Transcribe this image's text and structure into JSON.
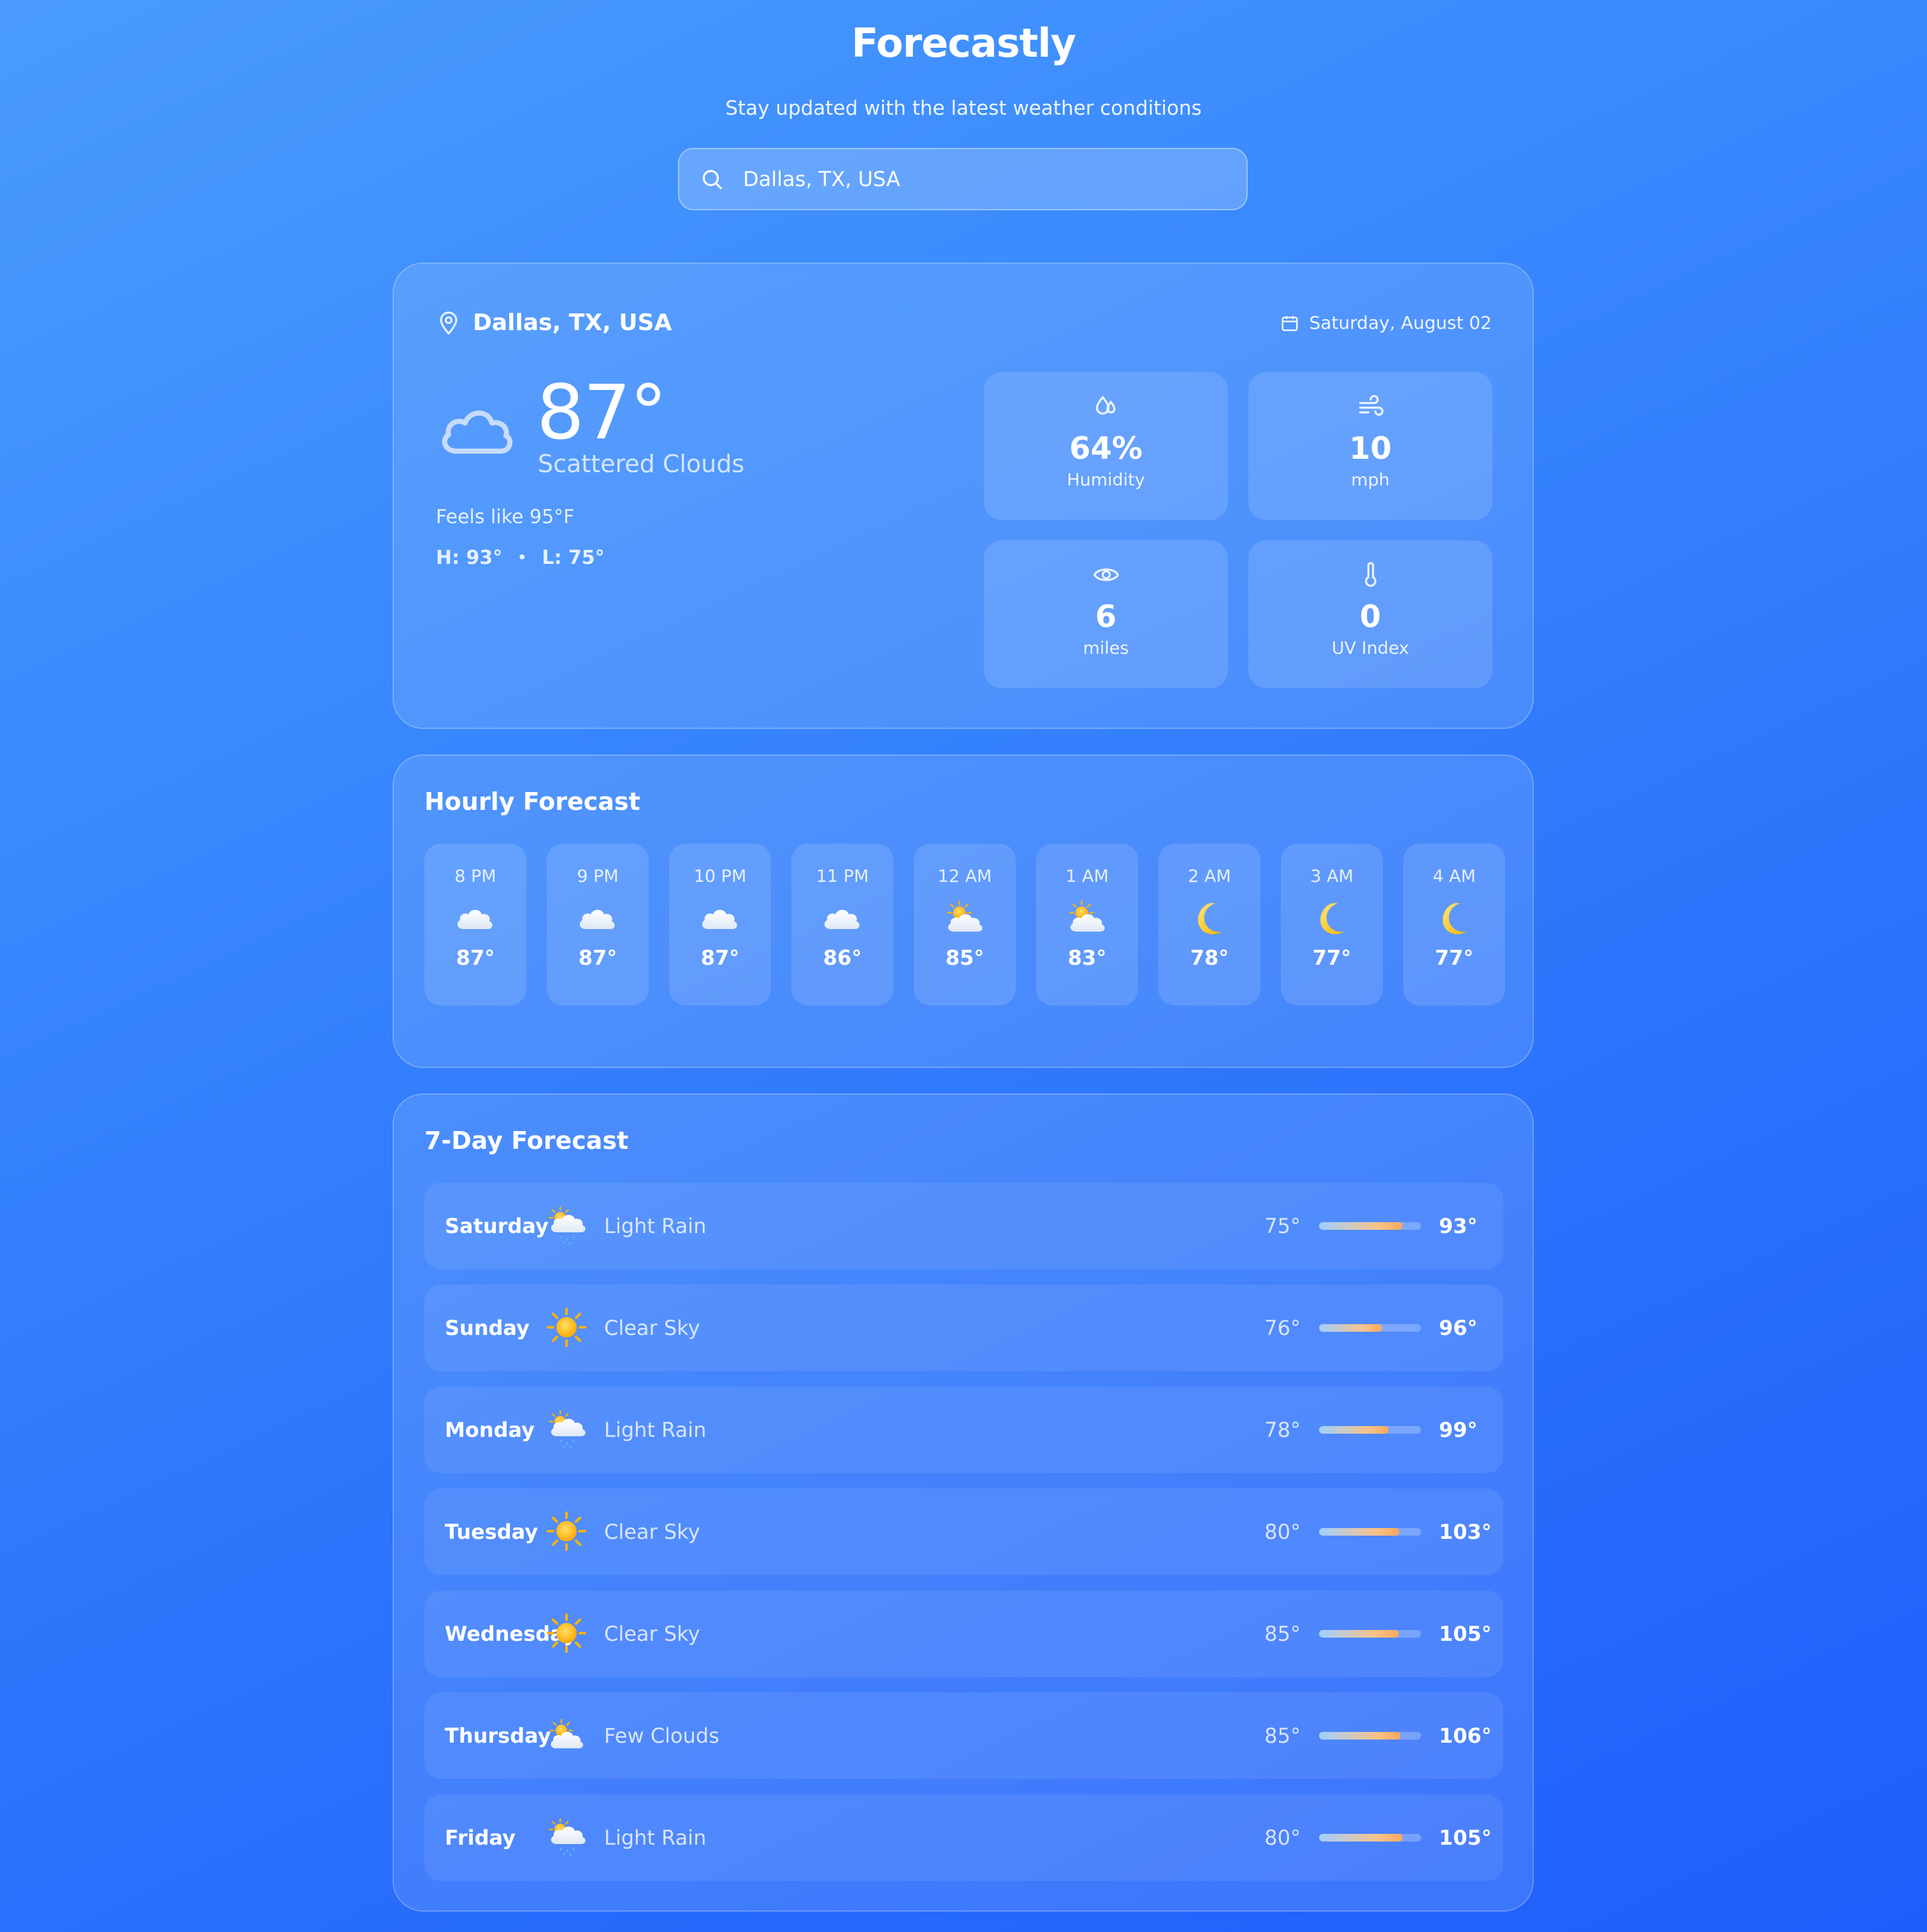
{
  "app": {
    "title": "Forecastly",
    "subtitle": "Stay updated with the latest weather conditions"
  },
  "search": {
    "value": "Dallas, TX, USA",
    "icon": "search-icon"
  },
  "current": {
    "location": "Dallas, TX, USA",
    "date": "Saturday, August 02",
    "temperature": "87°",
    "condition": "Scattered Clouds",
    "feels_like": "Feels like 95°F",
    "high": "H: 93°",
    "low": "L: 75°",
    "separator": "•",
    "icon": "cloud-icon",
    "stats": [
      {
        "value": "64%",
        "label": "Humidity",
        "icon": "humidity-icon"
      },
      {
        "value": "10",
        "label": "mph",
        "icon": "wind-icon"
      },
      {
        "value": "6",
        "label": "miles",
        "icon": "visibility-icon"
      },
      {
        "value": "0",
        "label": "UV Index",
        "icon": "thermometer-icon"
      }
    ]
  },
  "hourly": {
    "title": "Hourly Forecast",
    "items": [
      {
        "time": "8 PM",
        "icon": "cloud",
        "temp": "87°"
      },
      {
        "time": "9 PM",
        "icon": "cloud",
        "temp": "87°"
      },
      {
        "time": "10 PM",
        "icon": "cloud",
        "temp": "87°"
      },
      {
        "time": "11 PM",
        "icon": "cloud",
        "temp": "86°"
      },
      {
        "time": "12 AM",
        "icon": "sun-behind-cloud",
        "temp": "85°"
      },
      {
        "time": "1 AM",
        "icon": "sun-behind-cloud",
        "temp": "83°"
      },
      {
        "time": "2 AM",
        "icon": "crescent-moon",
        "temp": "78°"
      },
      {
        "time": "3 AM",
        "icon": "crescent-moon",
        "temp": "77°"
      },
      {
        "time": "4 AM",
        "icon": "crescent-moon",
        "temp": "77°"
      }
    ]
  },
  "daily": {
    "title": "7-Day Forecast",
    "days": [
      {
        "name": "Saturday",
        "icon": "sun-rain-cloud",
        "condition": "Light Rain",
        "low": "75°",
        "high": "93°",
        "range_fraction": 0.82
      },
      {
        "name": "Sunday",
        "icon": "sun",
        "condition": "Clear Sky",
        "low": "76°",
        "high": "96°",
        "range_fraction": 0.62
      },
      {
        "name": "Monday",
        "icon": "sun-rain-cloud",
        "condition": "Light Rain",
        "low": "78°",
        "high": "99°",
        "range_fraction": 0.68
      },
      {
        "name": "Tuesday",
        "icon": "sun",
        "condition": "Clear Sky",
        "low": "80°",
        "high": "103°",
        "range_fraction": 0.79
      },
      {
        "name": "Wednesday",
        "icon": "sun",
        "condition": "Clear Sky",
        "low": "85°",
        "high": "105°",
        "range_fraction": 0.78
      },
      {
        "name": "Thursday",
        "icon": "sun-behind-cloud",
        "condition": "Few Clouds",
        "low": "85°",
        "high": "106°",
        "range_fraction": 0.8
      },
      {
        "name": "Friday",
        "icon": "sun-rain-cloud",
        "condition": "Light Rain",
        "low": "80°",
        "high": "105°",
        "range_fraction": 0.82
      }
    ]
  },
  "colors": {
    "bg_top": "#4a9bfd",
    "bg_bottom": "#1f5efb",
    "bar_cool": "#9fd0ff",
    "bar_warm": "#f9a85e",
    "sun": "#ffc21a",
    "moon": "#ffcc33"
  }
}
